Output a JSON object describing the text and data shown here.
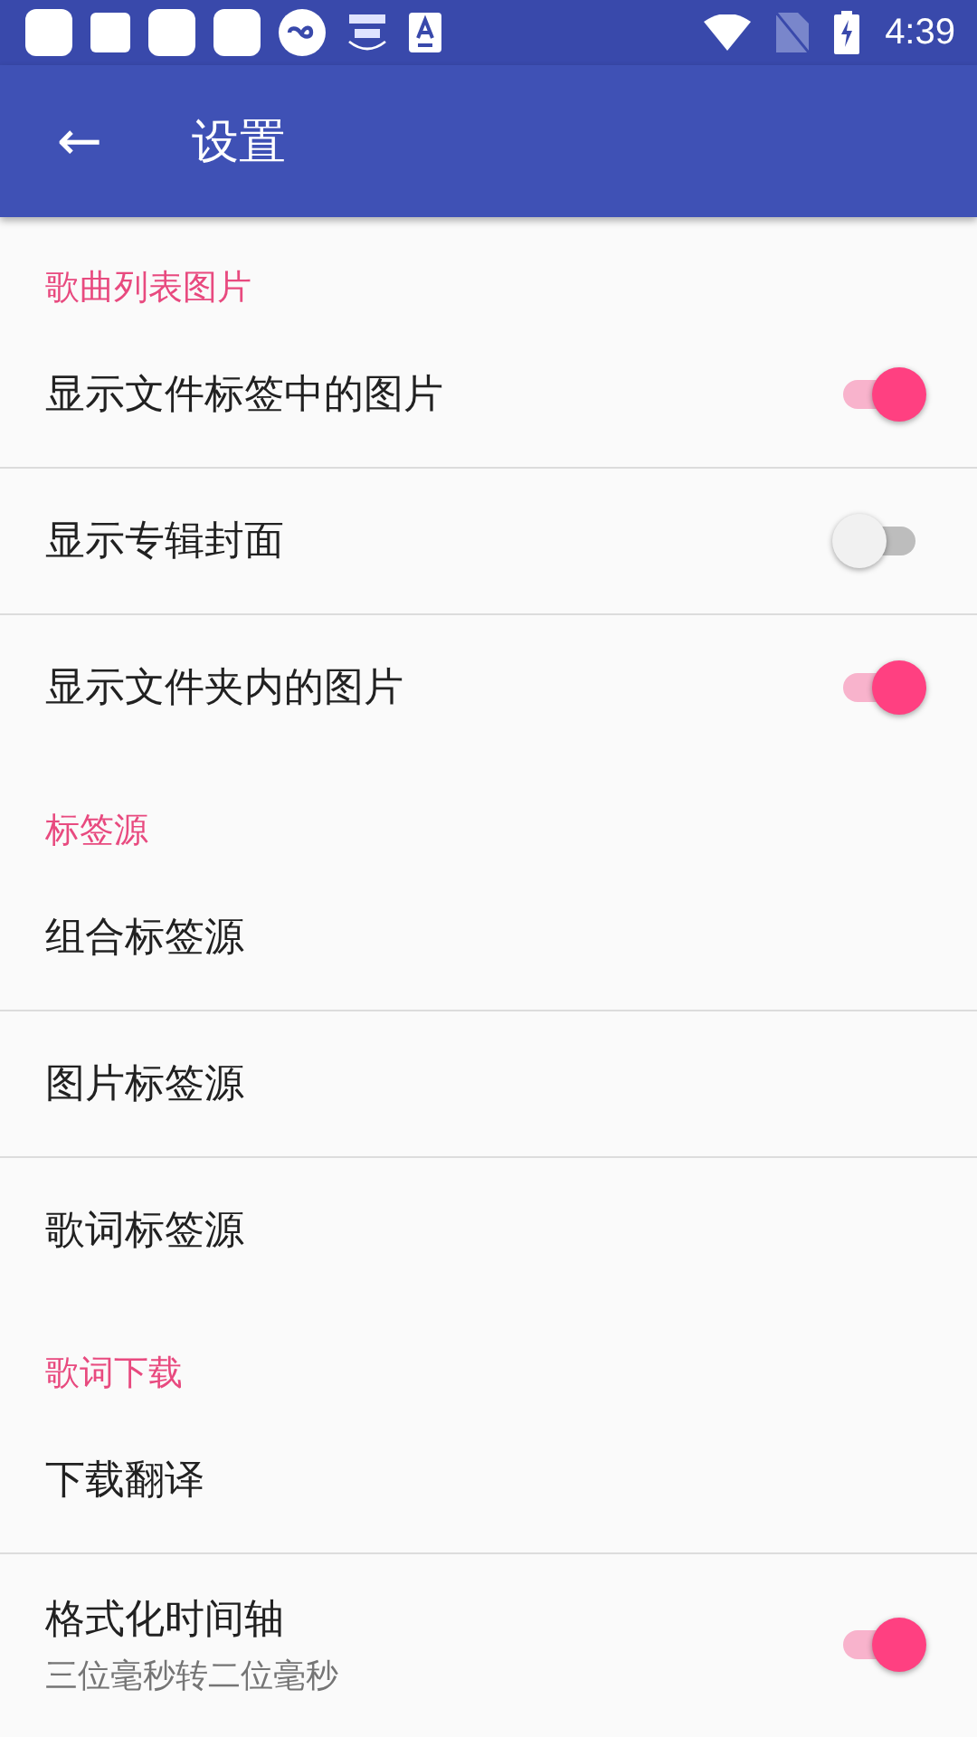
{
  "status_bar": {
    "time": "4:39"
  },
  "app_bar": {
    "back": "←",
    "title": "设置"
  },
  "sections": [
    {
      "title": "歌曲列表图片",
      "items": [
        {
          "kind": "switch",
          "label": "显示文件标签中的图片",
          "on": true
        },
        {
          "kind": "switch",
          "label": "显示专辑封面",
          "on": false
        },
        {
          "kind": "switch",
          "label": "显示文件夹内的图片",
          "on": true
        }
      ]
    },
    {
      "title": "标签源",
      "items": [
        {
          "kind": "text",
          "label": "组合标签源"
        },
        {
          "kind": "text",
          "label": "图片标签源"
        },
        {
          "kind": "text",
          "label": "歌词标签源"
        }
      ]
    },
    {
      "title": "歌词下载",
      "items": [
        {
          "kind": "text",
          "label": "下载翻译"
        },
        {
          "kind": "switch",
          "label": "格式化时间轴",
          "summary": "三位毫秒转二位毫秒",
          "on": true
        }
      ]
    }
  ]
}
